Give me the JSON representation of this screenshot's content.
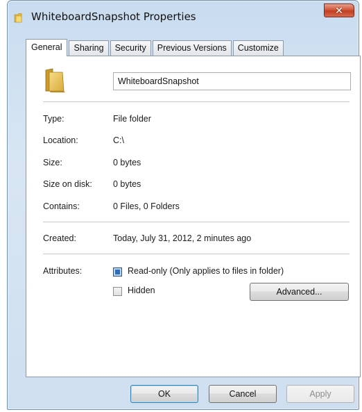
{
  "window": {
    "title": "WhiteboardSnapshot Properties",
    "close_label": "✕"
  },
  "tabs": [
    {
      "label": "General",
      "active": true
    },
    {
      "label": "Sharing",
      "active": false
    },
    {
      "label": "Security",
      "active": false
    },
    {
      "label": "Previous Versions",
      "active": false
    },
    {
      "label": "Customize",
      "active": false
    }
  ],
  "general": {
    "name": "WhiteboardSnapshot",
    "fields": {
      "type": {
        "label": "Type:",
        "value": "File folder"
      },
      "location": {
        "label": "Location:",
        "value": "C:\\"
      },
      "size": {
        "label": "Size:",
        "value": "0 bytes"
      },
      "size_on_disk": {
        "label": "Size on disk:",
        "value": "0 bytes"
      },
      "contains": {
        "label": "Contains:",
        "value": "0 Files, 0 Folders"
      },
      "created": {
        "label": "Created:",
        "value": "Today, July 31, 2012, 2 minutes ago"
      }
    },
    "attributes": {
      "label": "Attributes:",
      "readonly": {
        "label": "Read-only (Only applies to files in folder)",
        "state": "indeterminate"
      },
      "hidden": {
        "label": "Hidden",
        "state": "unchecked"
      },
      "advanced_label": "Advanced..."
    }
  },
  "buttons": {
    "ok": "OK",
    "cancel": "Cancel",
    "apply": "Apply"
  },
  "colors": {
    "folder": "#e8c04a",
    "checkbox_fill": "#2e6db3",
    "close_button": "#c94a2e"
  }
}
